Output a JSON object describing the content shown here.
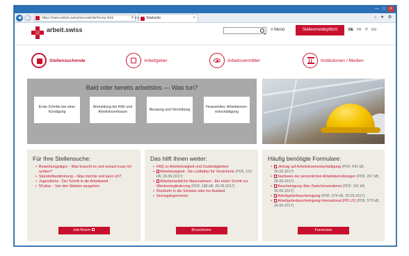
{
  "browser": {
    "url": "https://www.arbeit.swiss/secoalv/de/home.html",
    "url_tools": "P ▾ ♠ C",
    "tab_title": "Startseite",
    "tab_close": "×",
    "win_buttons": [
      "—",
      "□",
      "×"
    ],
    "nav_icons": [
      "◀",
      "▶"
    ],
    "right_icons": "⌂ ★ ✿"
  },
  "header": {
    "logo_text": "arbeit.swiss",
    "search_placeholder": "",
    "menu_label": "≡ Menü",
    "cta_label": "Stellenmeldepflicht",
    "languages": [
      {
        "code": "DE",
        "active": true
      },
      {
        "code": "FR",
        "active": false
      },
      {
        "code": "IT",
        "active": false
      },
      {
        "code": "EN",
        "active": false
      }
    ]
  },
  "groups": [
    {
      "label": "Stellensuchende",
      "icon": "jobseeker-icon",
      "active": true
    },
    {
      "label": "Arbeitgeber",
      "icon": "building-icon",
      "active": false
    },
    {
      "label": "Arbeitsvermittler",
      "icon": "eye-icon",
      "active": false
    },
    {
      "label": "Institutionen / Medien",
      "icon": "institution-icon",
      "active": false
    }
  ],
  "hero": {
    "title": "Bald oder bereits arbeitslos — Was tun?",
    "boxes": [
      "Erste Schritte bei einer Kündigung",
      "Anmeldung bei RAV und Arbeitslosenkasse",
      "Beratung und Vermittlung",
      "Finanzielles: Arbeitslosen-entschädigung"
    ]
  },
  "boxes": [
    {
      "title": "Für Ihre Stellensuche:",
      "items": [
        {
          "text": "Bewerbungstipps – Was braucht es und worauf muss ich achten?",
          "pdf": false,
          "meta": ""
        },
        {
          "text": "Standortbestimmung – Was möchte und kann ich?",
          "pdf": false,
          "meta": ""
        },
        {
          "text": "Jugendliche - Der Schritt in die Arbeitswelt",
          "pdf": false,
          "meta": ""
        },
        {
          "text": "50 plus – Von den Stärken ausgehen",
          "pdf": false,
          "meta": ""
        }
      ],
      "button": "Job-Room",
      "button_external": true
    },
    {
      "title": "Das hilft Ihnen weiter:",
      "items": [
        {
          "text": "FAQ zu Arbeitslosigkeit und Zuständigkeiten",
          "pdf": false,
          "meta": ""
        },
        {
          "text": "Arbeitslosigkeit - Ein Leitfaden für Versicherte",
          "pdf": true,
          "meta": "(PDF, 123 kB, 26.09.2017)"
        },
        {
          "text": "Arbeitsmarktliche Massnahmen - Ein erster Schritt zur Wiedereingliederung",
          "pdf": true,
          "meta": "(PDF, 188 kB, 26.09.2017)"
        },
        {
          "text": "Rückkehr in die Schweiz oder ins Ausland",
          "pdf": false,
          "meta": ""
        },
        {
          "text": "Grenzgänger/innen",
          "pdf": false,
          "meta": ""
        }
      ],
      "button": "Broschüren",
      "button_external": false
    },
    {
      "title": "Häufig benötigte Formulare:",
      "items": [
        {
          "text": "„Antrag auf Arbeitslosenentschädigung",
          "pdf": true,
          "meta": "(PDF, 641 kB, 26.09.2017)"
        },
        {
          "text": "Nachweis der persönlichen Arbeitsbemühungen",
          "pdf": true,
          "meta": "(PDF, 267 kB, 26.09.2017)"
        },
        {
          "text": "Bescheinigung über Zwischenverdienst",
          "pdf": true,
          "meta": "(PDF, 151 kB, 26.09.2017)"
        },
        {
          "text": "Arbeitgeberbescheinigung",
          "pdf": true,
          "meta": "(PDF, 574 kB, 26.09.2017)"
        },
        {
          "text": "Arbeitgeberbescheinigung international (PD U1)",
          "pdf": true,
          "meta": "(PDF, 575 kB, 26.09.2017)"
        }
      ],
      "button": "Formulare",
      "button_external": false
    }
  ],
  "colors": {
    "brand": "#c8102e",
    "hero_gray": "#a9a9a9",
    "box_bg": "#efece6",
    "window_blue": "#2b71b8"
  }
}
